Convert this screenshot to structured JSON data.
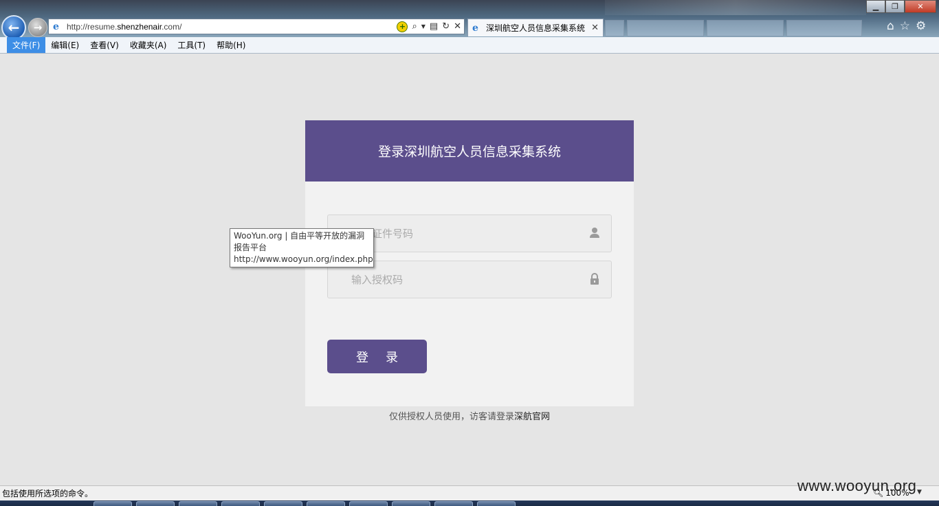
{
  "browser": {
    "url_prefix": "http://resume.",
    "url_domain": "shenzhenair",
    "url_suffix": ".com/",
    "tab_title": "深圳航空人员信息采集系统",
    "menu": [
      "文件(F)",
      "编辑(E)",
      "查看(V)",
      "收藏夹(A)",
      "工具(T)",
      "帮助(H)"
    ],
    "status_text": "包括使用所选项的命令。",
    "zoom": "100%"
  },
  "login": {
    "title": "登录深圳航空人员信息采集系统",
    "id_placeholder": "输入证件号码",
    "code_placeholder": "输入授权码",
    "button": "登 录",
    "note_prefix": "仅供授权人员使用，访客请登录",
    "note_link": "深航官网"
  },
  "tooltip": {
    "line1": "WooYun.org | 自由平等开放的漏洞",
    "line2": "报告平台",
    "line3": "http://www.wooyun.org/index.php"
  },
  "watermark": "www.wooyun.org",
  "colors": {
    "accent": "#5b4e8c",
    "page_bg": "#e5e5e5"
  }
}
